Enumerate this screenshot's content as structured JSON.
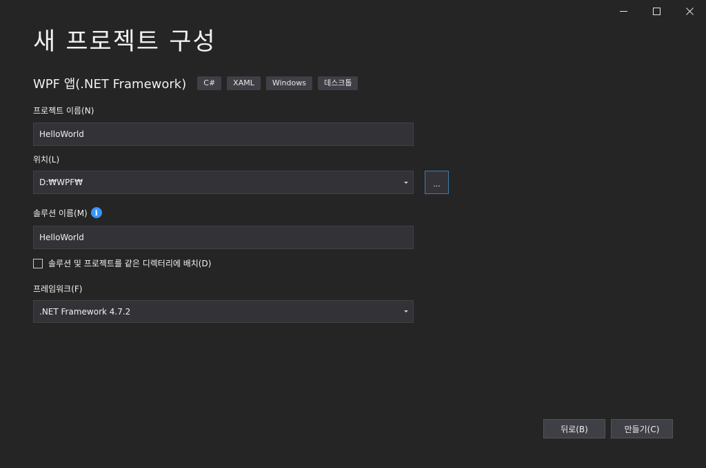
{
  "window": {
    "minimize_icon": "minimize-icon",
    "maximize_icon": "maximize-icon",
    "close_icon": "close-icon"
  },
  "header": {
    "title": "새 프로젝트 구성",
    "template_name": "WPF 앱(.NET Framework)",
    "tags": [
      "C#",
      "XAML",
      "Windows",
      "데스크톱"
    ]
  },
  "project_name": {
    "label": "프로젝트 이름(N)",
    "value": "HelloWorld"
  },
  "location": {
    "label": "위치(L)",
    "value": "D:₩WPF₩",
    "browse_label": "..."
  },
  "solution_name": {
    "label": "솔루션 이름(M)",
    "info_glyph": "i",
    "value": "HelloWorld"
  },
  "same_directory": {
    "label": "솔루션 및 프로젝트를 같은 디렉터리에 배치(D)",
    "checked": false
  },
  "framework": {
    "label": "프레임워크(F)",
    "value": ".NET Framework 4.7.2"
  },
  "footer": {
    "back_label": "뒤로(B)",
    "create_label": "만들기(C)"
  },
  "colors": {
    "background": "#252526",
    "input_background": "#333337",
    "focus_border": "#3c7fb1",
    "info_blue": "#3794ff"
  }
}
